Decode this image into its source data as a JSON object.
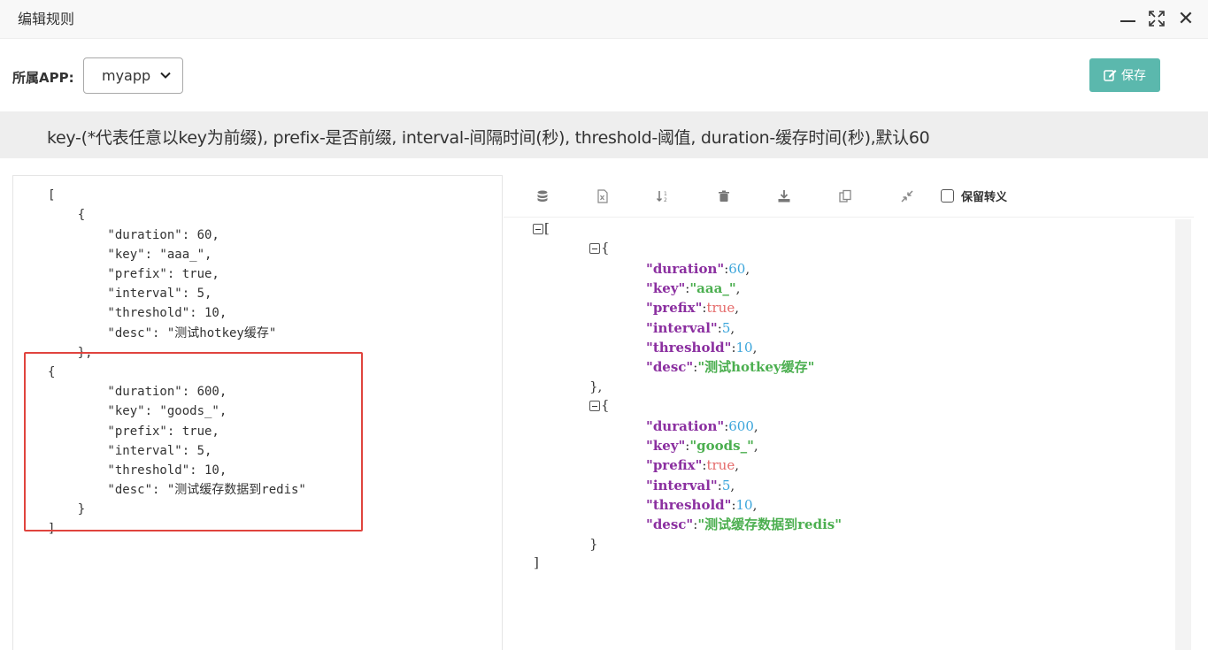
{
  "window": {
    "title": "编辑规则",
    "min_icon": "minimize-icon",
    "max_icon": "maximize-icon",
    "close_icon": "close-icon",
    "close_glyph": "✕"
  },
  "app_selector": {
    "label": "所属APP:",
    "selected": "myapp"
  },
  "save_button": {
    "label": "保存",
    "icon": "edit-icon",
    "color": "#5bb8ad"
  },
  "help_text": "key-(*代表任意以key为前缀), prefix-是否前缀, interval-间隔时间(秒), threshold-阈值, duration-缓存时间(秒),默认60",
  "editor": {
    "lines": [
      "[",
      "    {",
      "        \"duration\": 60,",
      "        \"key\": \"aaa_\",",
      "        \"prefix\": true,",
      "        \"interval\": 5,",
      "        \"threshold\": 10,",
      "        \"desc\": \"测试hotkey缓存\"",
      "    },",
      "{",
      "        \"duration\": 600,",
      "        \"key\": \"goods_\",",
      "        \"prefix\": true,",
      "        \"interval\": 5,",
      "        \"threshold\": 10,",
      "        \"desc\": \"测试缓存数据到redis\"",
      "    }",
      "]"
    ]
  },
  "viewer": {
    "toolbar_icons": [
      "database-icon",
      "excel-icon",
      "sort-icon",
      "trash-icon",
      "download-icon",
      "copy-icon",
      "compress-icon"
    ],
    "keep_escape_label": "保留转义",
    "open_bracket": "[",
    "close_bracket": "]",
    "objects": [
      {
        "open": "{",
        "close": "},",
        "entries": [
          {
            "key": "\"duration\"",
            "value": "60",
            "type": "n"
          },
          {
            "key": "\"key\"",
            "value": "\"aaa_\"",
            "type": "s"
          },
          {
            "key": "\"prefix\"",
            "value": "true",
            "type": "b"
          },
          {
            "key": "\"interval\"",
            "value": "5",
            "type": "n"
          },
          {
            "key": "\"threshold\"",
            "value": "10",
            "type": "n"
          },
          {
            "key": "\"desc\"",
            "value": "\"测试hotkey缓存\"",
            "type": "s"
          }
        ]
      },
      {
        "open": "{",
        "close": "}",
        "entries": [
          {
            "key": "\"duration\"",
            "value": "600",
            "type": "n"
          },
          {
            "key": "\"key\"",
            "value": "\"goods_\"",
            "type": "s"
          },
          {
            "key": "\"prefix\"",
            "value": "true",
            "type": "b"
          },
          {
            "key": "\"interval\"",
            "value": "5",
            "type": "n"
          },
          {
            "key": "\"threshold\"",
            "value": "10",
            "type": "n"
          },
          {
            "key": "\"desc\"",
            "value": "\"测试缓存数据到redis\"",
            "type": "s"
          }
        ]
      }
    ]
  }
}
